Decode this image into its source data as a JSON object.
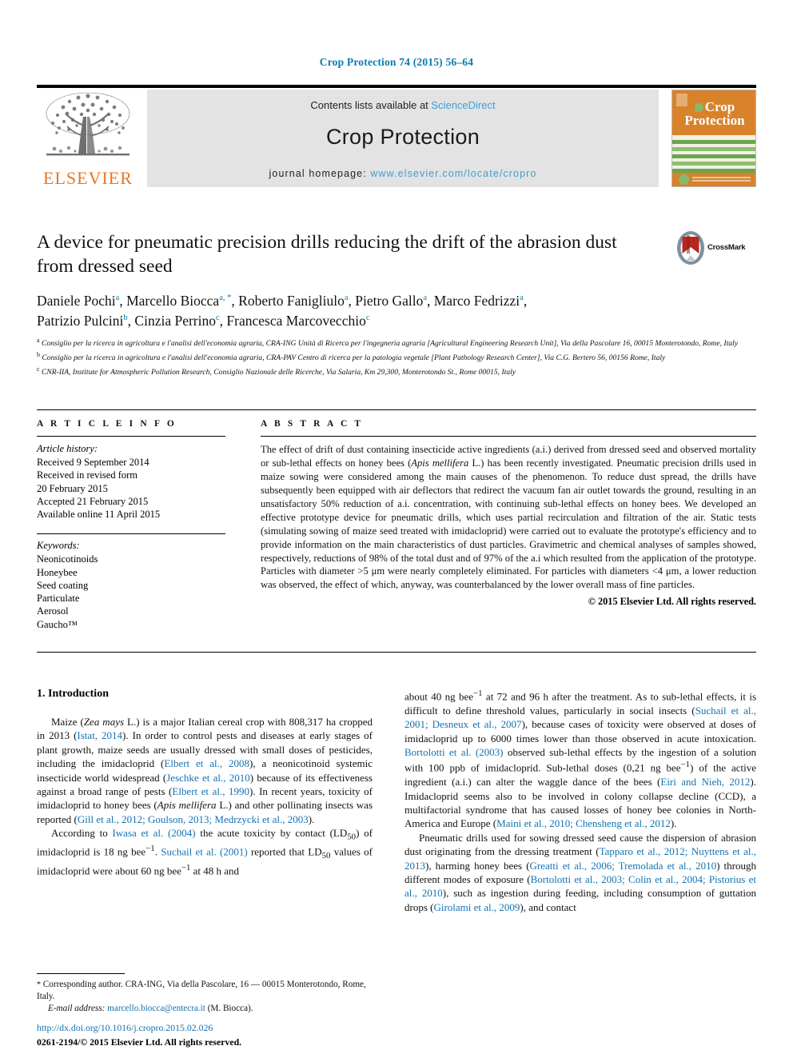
{
  "running_head": "Crop Protection 74 (2015) 56–64",
  "header": {
    "publisher_logo_name": "ELSEVIER",
    "contents_prefix": "Contents lists available at ",
    "contents_link": "ScienceDirect",
    "journal_title": "Crop Protection",
    "homepage_label": "journal homepage: ",
    "homepage_url": "www.elsevier.com/locate/cropro",
    "cover": {
      "line1": "Crop",
      "line2": "Protection"
    }
  },
  "article": {
    "title": "A device for pneumatic precision drills reducing the drift of the abrasion dust from dressed seed",
    "crossmark_label": "CrossMark",
    "authors_line1_parts": [
      {
        "name": "Daniele Pochi",
        "sup": "a",
        "sep": ", "
      },
      {
        "name": "Marcello Biocca",
        "sup": "a, *",
        "sep": ", "
      },
      {
        "name": "Roberto Fanigliulo",
        "sup": "a",
        "sep": ", "
      },
      {
        "name": "Pietro Gallo",
        "sup": "a",
        "sep": ", "
      },
      {
        "name": "Marco Fedrizzi",
        "sup": "a",
        "sep": ","
      }
    ],
    "authors_line2_parts": [
      {
        "name": "Patrizio Pulcini",
        "sup": "b",
        "sep": ", "
      },
      {
        "name": "Cinzia Perrino",
        "sup": "c",
        "sep": ", "
      },
      {
        "name": "Francesca Marcovecchio",
        "sup": "c",
        "sep": ""
      }
    ],
    "affiliations": [
      {
        "sup": "a",
        "text": "Consiglio per la ricerca in agricoltura e l'analisi dell'economia agraria, CRA-ING Unità di Ricerca per l'ingegneria agraria [Agricultural Engineering Research Unit], Via della Pascolare 16, 00015 Monterotondo, Rome, Italy"
      },
      {
        "sup": "b",
        "text": "Consiglio per la ricerca in agricoltura e l'analisi dell'economia agraria, CRA-PAV Centro di ricerca per la patologia vegetale [Plant Pathology Research Center], Via C.G. Bertero 56, 00156 Rome, Italy"
      },
      {
        "sup": "c",
        "text": "CNR-IIA, Institute for Atmospheric Pollution Research, Consiglio Nazionale delle Ricerche, Via Salaria, Km 29,300, Monterotondo St., Rome 00015, Italy"
      }
    ]
  },
  "article_info": {
    "heading": "A R T I C L E   I N F O",
    "history_label": "Article history:",
    "history": [
      "Received 9 September 2014",
      "Received in revised form",
      "20 February 2015",
      "Accepted 21 February 2015",
      "Available online 11 April 2015"
    ],
    "keywords_label": "Keywords:",
    "keywords": [
      "Neonicotinoids",
      "Honeybee",
      "Seed coating",
      "Particulate",
      "Aerosol",
      "Gaucho™"
    ]
  },
  "abstract": {
    "heading": "A B S T R A C T",
    "paragraph_pre": "The effect of drift of dust containing insecticide active ingredients (a.i.) derived from dressed seed and observed mortality or sub-lethal effects on honey bees (",
    "species_italic": "Apis mellifera",
    "paragraph_post": " L.) has been recently investigated. Pneumatic precision drills used in maize sowing were considered among the main causes of the phenomenon. To reduce dust spread, the drills have subsequently been equipped with air deflectors that redirect the vacuum fan air outlet towards the ground, resulting in an unsatisfactory 50% reduction of a.i. concentration, with continuing sub-lethal effects on honey bees. We developed an effective prototype device for pneumatic drills, which uses partial recirculation and filtration of the air. Static tests (simulating sowing of maize seed treated with imidacloprid) were carried out to evaluate the prototype's efficiency and to provide information on the main characteristics of dust particles. Gravimetric and chemical analyses of samples showed, respectively, reductions of 98% of the total dust and of 97% of the a.i which resulted from the application of the prototype. Particles with diameter >5 μm were nearly completely eliminated. For particles with diameters <4 μm, a lower reduction was observed, the effect of which, anyway, was counterbalanced by the lower overall mass of fine particles.",
    "copyright": "© 2015 Elsevier Ltd. All rights reserved."
  },
  "body": {
    "section_number_title": "1. Introduction",
    "left_paragraphs": [
      [
        {
          "t": "Maize ("
        },
        {
          "t": "Zea mays",
          "s": "it"
        },
        {
          "t": " L.) is a major Italian cereal crop with 808,317 ha cropped in 2013 ("
        },
        {
          "t": "Istat, 2014",
          "s": "ref"
        },
        {
          "t": "). In order to control pests and diseases at early stages of plant growth, maize seeds are usually dressed with small doses of pesticides, including the imidacloprid ("
        },
        {
          "t": "Elbert et al., 2008",
          "s": "ref"
        },
        {
          "t": "), a neonicotinoid systemic insecticide world widespread ("
        },
        {
          "t": "Jeschke et al., 2010",
          "s": "ref"
        },
        {
          "t": ") because of its effectiveness against a broad range of pests ("
        },
        {
          "t": "Elbert et al., 1990",
          "s": "ref"
        },
        {
          "t": "). In recent years, toxicity of imidacloprid to honey bees ("
        },
        {
          "t": "Apis mellifera",
          "s": "it"
        },
        {
          "t": " L.) and other pollinating insects was reported ("
        },
        {
          "t": "Gill et al., 2012; Goulson, 2013; Medrzycki et al., 2003",
          "s": "ref"
        },
        {
          "t": ")."
        }
      ],
      [
        {
          "t": "According to "
        },
        {
          "t": "Iwasa et al. (2004)",
          "s": "ref"
        },
        {
          "t": " the acute toxicity by contact (LD"
        },
        {
          "t": "50",
          "s": "sub"
        },
        {
          "t": ") of imidacloprid is 18 ng bee"
        },
        {
          "t": "−1",
          "s": "sup"
        },
        {
          "t": ". "
        },
        {
          "t": "Suchail et al. (2001)",
          "s": "ref"
        },
        {
          "t": " reported that LD"
        },
        {
          "t": "50",
          "s": "sub"
        },
        {
          "t": " values of imidacloprid were about 60 ng bee"
        },
        {
          "t": "−1",
          "s": "sup"
        },
        {
          "t": " at 48 h and"
        }
      ]
    ],
    "right_paragraphs": [
      [
        {
          "t": "about 40 ng bee"
        },
        {
          "t": "−1",
          "s": "sup"
        },
        {
          "t": " at 72 and 96 h after the treatment. As to sub-lethal effects, it is difficult to define threshold values, particularly in social insects ("
        },
        {
          "t": "Suchail et al., 2001; Desneux et al., 2007",
          "s": "ref"
        },
        {
          "t": "), because cases of toxicity were observed at doses of imidacloprid up to 6000 times lower than those observed in acute intoxication. "
        },
        {
          "t": "Bortolotti et al. (2003)",
          "s": "ref"
        },
        {
          "t": " observed sub-lethal effects by the ingestion of a solution with 100 ppb of imidacloprid. Sub-lethal doses (0,21 ng bee"
        },
        {
          "t": "−1",
          "s": "sup"
        },
        {
          "t": ") of the active ingredient (a.i.) can alter the waggle dance of the bees ("
        },
        {
          "t": "Eiri and Nieh, 2012",
          "s": "ref"
        },
        {
          "t": "). Imidacloprid seems also to be involved in colony collapse decline (CCD), a multifactorial syndrome that has caused losses of honey bee colonies in North-America and Europe ("
        },
        {
          "t": "Maini et al., 2010; Chensheng et al., 2012",
          "s": "ref"
        },
        {
          "t": ")."
        }
      ],
      [
        {
          "t": "Pneumatic drills used for sowing dressed seed cause the dispersion of abrasion dust originating from the dressing treatment ("
        },
        {
          "t": "Tapparo et al., 2012; Nuyttens et al., 2013",
          "s": "ref"
        },
        {
          "t": "), harming honey bees ("
        },
        {
          "t": "Greatti et al., 2006; Tremolada et al., 2010",
          "s": "ref"
        },
        {
          "t": ") through different modes of exposure ("
        },
        {
          "t": "Bortolotti et al., 2003; Colin et al., 2004; Pistorius et al., 2010",
          "s": "ref"
        },
        {
          "t": "), such as ingestion during feeding, including consumption of guttation drops ("
        },
        {
          "t": "Girolami et al., 2009",
          "s": "ref"
        },
        {
          "t": "), and contact"
        }
      ]
    ]
  },
  "footnotes": {
    "corresponding": "Corresponding author. CRA-ING, Via della Pascolare, 16 — 00015 Monterotondo, Rome, Italy.",
    "email_label": "E-mail address:",
    "email": "marcello.biocca@entecra.it",
    "email_suffix": "(M. Biocca)."
  },
  "footer": {
    "doi": "http://dx.doi.org/10.1016/j.cropro.2015.02.026",
    "issn_line": "0261-2194/© 2015 Elsevier Ltd. All rights reserved."
  },
  "colors": {
    "link_blue": "#1472b0",
    "header_blue": "#0b7ab0",
    "sciencedirect_blue": "#3a9fd4",
    "elsevier_orange": "#e87722",
    "banner_gray": "#e3e3e3",
    "cover_orange": "#d8822a",
    "cover_green": "#86b96b"
  }
}
